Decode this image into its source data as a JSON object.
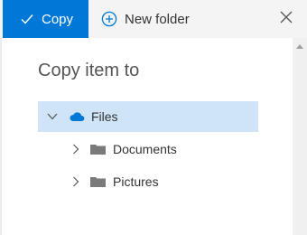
{
  "toolbar": {
    "copy_label": "Copy",
    "new_folder_label": "New folder"
  },
  "dialog": {
    "title": "Copy item to"
  },
  "tree": {
    "root": {
      "label": "Files",
      "icon": "cloud-icon",
      "expanded": true,
      "selected": true
    },
    "children": [
      {
        "label": "Documents",
        "icon": "folder-icon"
      },
      {
        "label": "Pictures",
        "icon": "folder-icon"
      }
    ]
  },
  "colors": {
    "accent": "#0078d7",
    "selection": "#cfe4f7",
    "folder": "#7a7a7a",
    "cloud": "#0078d7"
  }
}
